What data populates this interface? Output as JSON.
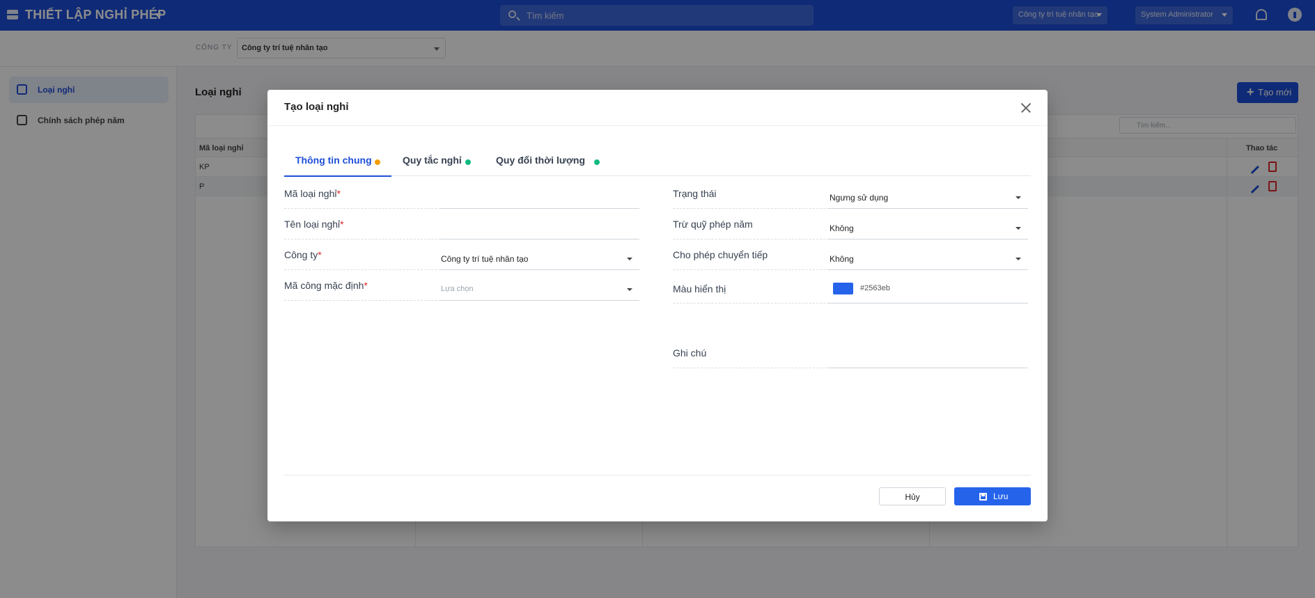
{
  "topbar": {
    "title": "THIẾT LẬP NGHỈ PHÉP",
    "search_placeholder": "Tìm kiếm",
    "company_select": "Công ty trí tuệ nhân tạo",
    "user_select": "System Administrator"
  },
  "filterbar": {
    "label": "CÔNG TY",
    "company": "Công ty trí tuệ nhân tạo"
  },
  "sidebar": {
    "items": [
      {
        "label": "Loại nghỉ",
        "icon": "leave-type-icon"
      },
      {
        "label": "Chính sách phép năm",
        "icon": "calendar-icon"
      }
    ]
  },
  "content": {
    "title": "Loại nghỉ",
    "new_button": "Tạo mới",
    "search_placeholder": "Tìm kiếm...",
    "columns": [
      "Mã loại nghỉ",
      "Thao tác"
    ],
    "rows": [
      {
        "code": "KP"
      },
      {
        "code": "P"
      }
    ]
  },
  "modal": {
    "title": "Tạo loại nghỉ",
    "tabs": [
      {
        "label": "Thông tin chung",
        "status_color": "#f59e0b"
      },
      {
        "label": "Quy tắc nghỉ",
        "status_color": "#10b981"
      },
      {
        "label": "Quy đổi thời lượng",
        "status_color": "#10b981"
      }
    ],
    "left_fields": {
      "code": {
        "label": "Mã loại nghỉ",
        "value": ""
      },
      "name": {
        "label": "Tên loại nghỉ",
        "value": ""
      },
      "company": {
        "label": "Công ty",
        "value": "Công ty trí tuệ nhân tạo"
      },
      "default_code": {
        "label": "Mã công mặc định",
        "placeholder": "Lựa chọn"
      }
    },
    "required_mark": "*",
    "right_fields": {
      "status": {
        "label": "Trạng thái",
        "value": "Ngưng sử dụng"
      },
      "deduct": {
        "label": "Trừ quỹ phép năm",
        "value": "Không"
      },
      "carry": {
        "label": "Cho phép chuyển tiếp",
        "value": "Không"
      },
      "color": {
        "label": "Màu hiển thị",
        "value": "#2563eb"
      },
      "note": {
        "label": "Ghi chú",
        "value": ""
      }
    },
    "buttons": {
      "cancel": "Hủy",
      "save": "Lưu"
    }
  },
  "colors": {
    "primary": "#1d4ed8",
    "save_button": "#2563eb",
    "required": "#dc2626"
  }
}
